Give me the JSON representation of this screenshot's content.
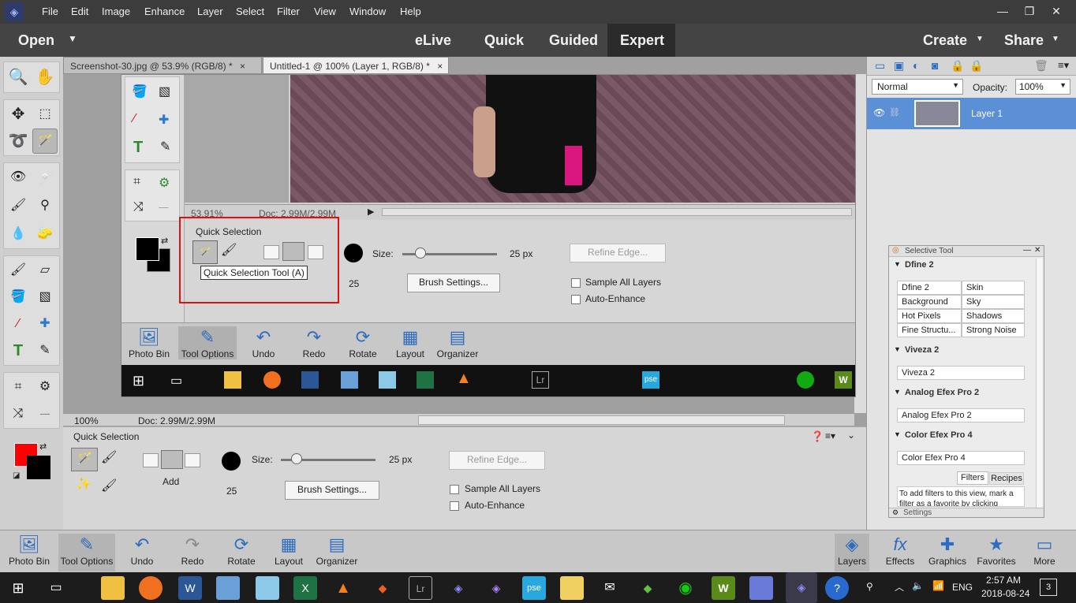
{
  "menubar": {
    "items": [
      "File",
      "Edit",
      "Image",
      "Enhance",
      "Layer",
      "Select",
      "Filter",
      "View",
      "Window",
      "Help"
    ]
  },
  "modebar": {
    "open": "Open",
    "modes": [
      "eLive",
      "Quick",
      "Guided",
      "Expert"
    ],
    "active_mode": "Expert",
    "create": "Create",
    "share": "Share"
  },
  "tabs": [
    {
      "label": "Screenshot-30.jpg @ 53.9% (RGB/8) *",
      "close": "×"
    },
    {
      "label": "Untitled-1 @ 100% (Layer 1, RGB/8) *",
      "close": "×"
    }
  ],
  "status": {
    "zoom": "100%",
    "doc": "Doc: 2.99M/2.99M"
  },
  "inner": {
    "zoom": "53.91%",
    "doc": "Doc: 2.99M/2.99M",
    "options_title": "Quick Selection",
    "tooltip": "Quick Selection Tool (A)",
    "size_label": "Size:",
    "size_value": "25 px",
    "brush_num": "25",
    "brush_settings": "Brush Settings...",
    "refine_edge": "Refine Edge...",
    "sample_all": "Sample All Layers",
    "auto_enhance": "Auto-Enhance",
    "bottom": [
      "Photo Bin",
      "Tool Options",
      "Undo",
      "Redo",
      "Rotate",
      "Layout",
      "Organizer"
    ]
  },
  "tooloptions": {
    "title": "Quick Selection",
    "add_label": "Add",
    "size_label": "Size:",
    "size_value": "25 px",
    "size_fraction": 0.17,
    "brush_num": "25",
    "brush_settings": "Brush Settings...",
    "refine_edge": "Refine Edge...",
    "sample_all": "Sample All Layers",
    "auto_enhance": "Auto-Enhance"
  },
  "layers": {
    "blend_mode": "Normal",
    "opacity_label": "Opacity:",
    "opacity": "100%",
    "layer_name": "Layer 1"
  },
  "selective": {
    "title": "Selective Tool",
    "sections": [
      {
        "name": "Dfine 2",
        "buttons": [
          "Dfine 2",
          "Skin",
          "Background",
          "Sky",
          "Hot Pixels",
          "Shadows",
          "Fine Structu...",
          "Strong Noise"
        ]
      },
      {
        "name": "Viveza 2",
        "buttons": [
          "Viveza 2"
        ]
      },
      {
        "name": "Analog Efex Pro 2",
        "buttons": [
          "Analog Efex Pro 2"
        ]
      },
      {
        "name": "Color Efex Pro 4",
        "buttons": [
          "Color Efex Pro 4"
        ]
      }
    ],
    "tabs": [
      "Filters",
      "Recipes"
    ],
    "note": "To add filters to this view, mark a filter as a favorite by clicking",
    "settings": "Settings"
  },
  "bottombar": {
    "left": [
      "Photo Bin",
      "Tool Options",
      "Undo",
      "Redo",
      "Rotate",
      "Layout",
      "Organizer"
    ],
    "right": [
      "Layers",
      "Effects",
      "Graphics",
      "Favorites",
      "More"
    ]
  },
  "taskbar": {
    "time": "2:57 AM",
    "date": "2018-08-24",
    "lang": "ENG",
    "notif_count": "3"
  },
  "colors": {
    "foreground": "#ff0000",
    "background": "#000000",
    "highlight_box": "#e01010",
    "layer_selected": "#5b8fd6"
  }
}
